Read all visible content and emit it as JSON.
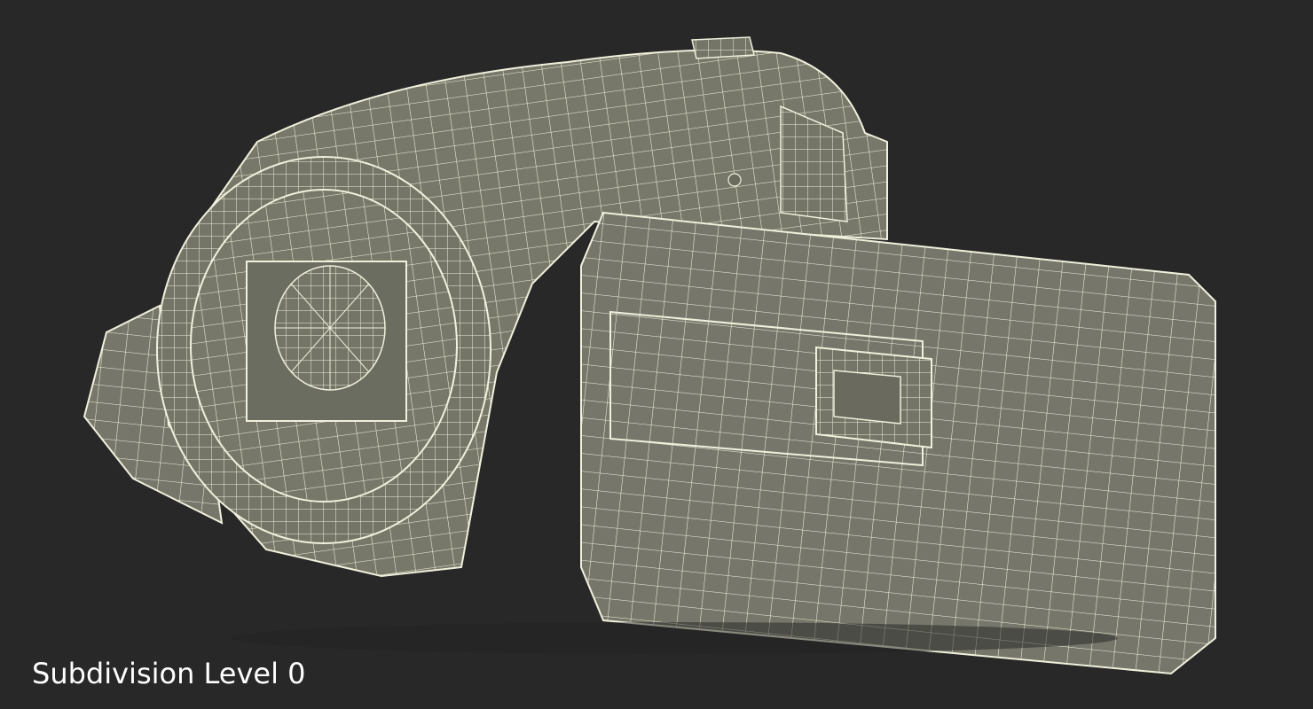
{
  "viewport": {
    "background": "#282828",
    "subject": "camcorder-wireframe-render"
  },
  "model": {
    "surface_color": "#777869",
    "wire_color": "#f0f0dc"
  },
  "caption": {
    "text": "Subdivision Level 0"
  }
}
